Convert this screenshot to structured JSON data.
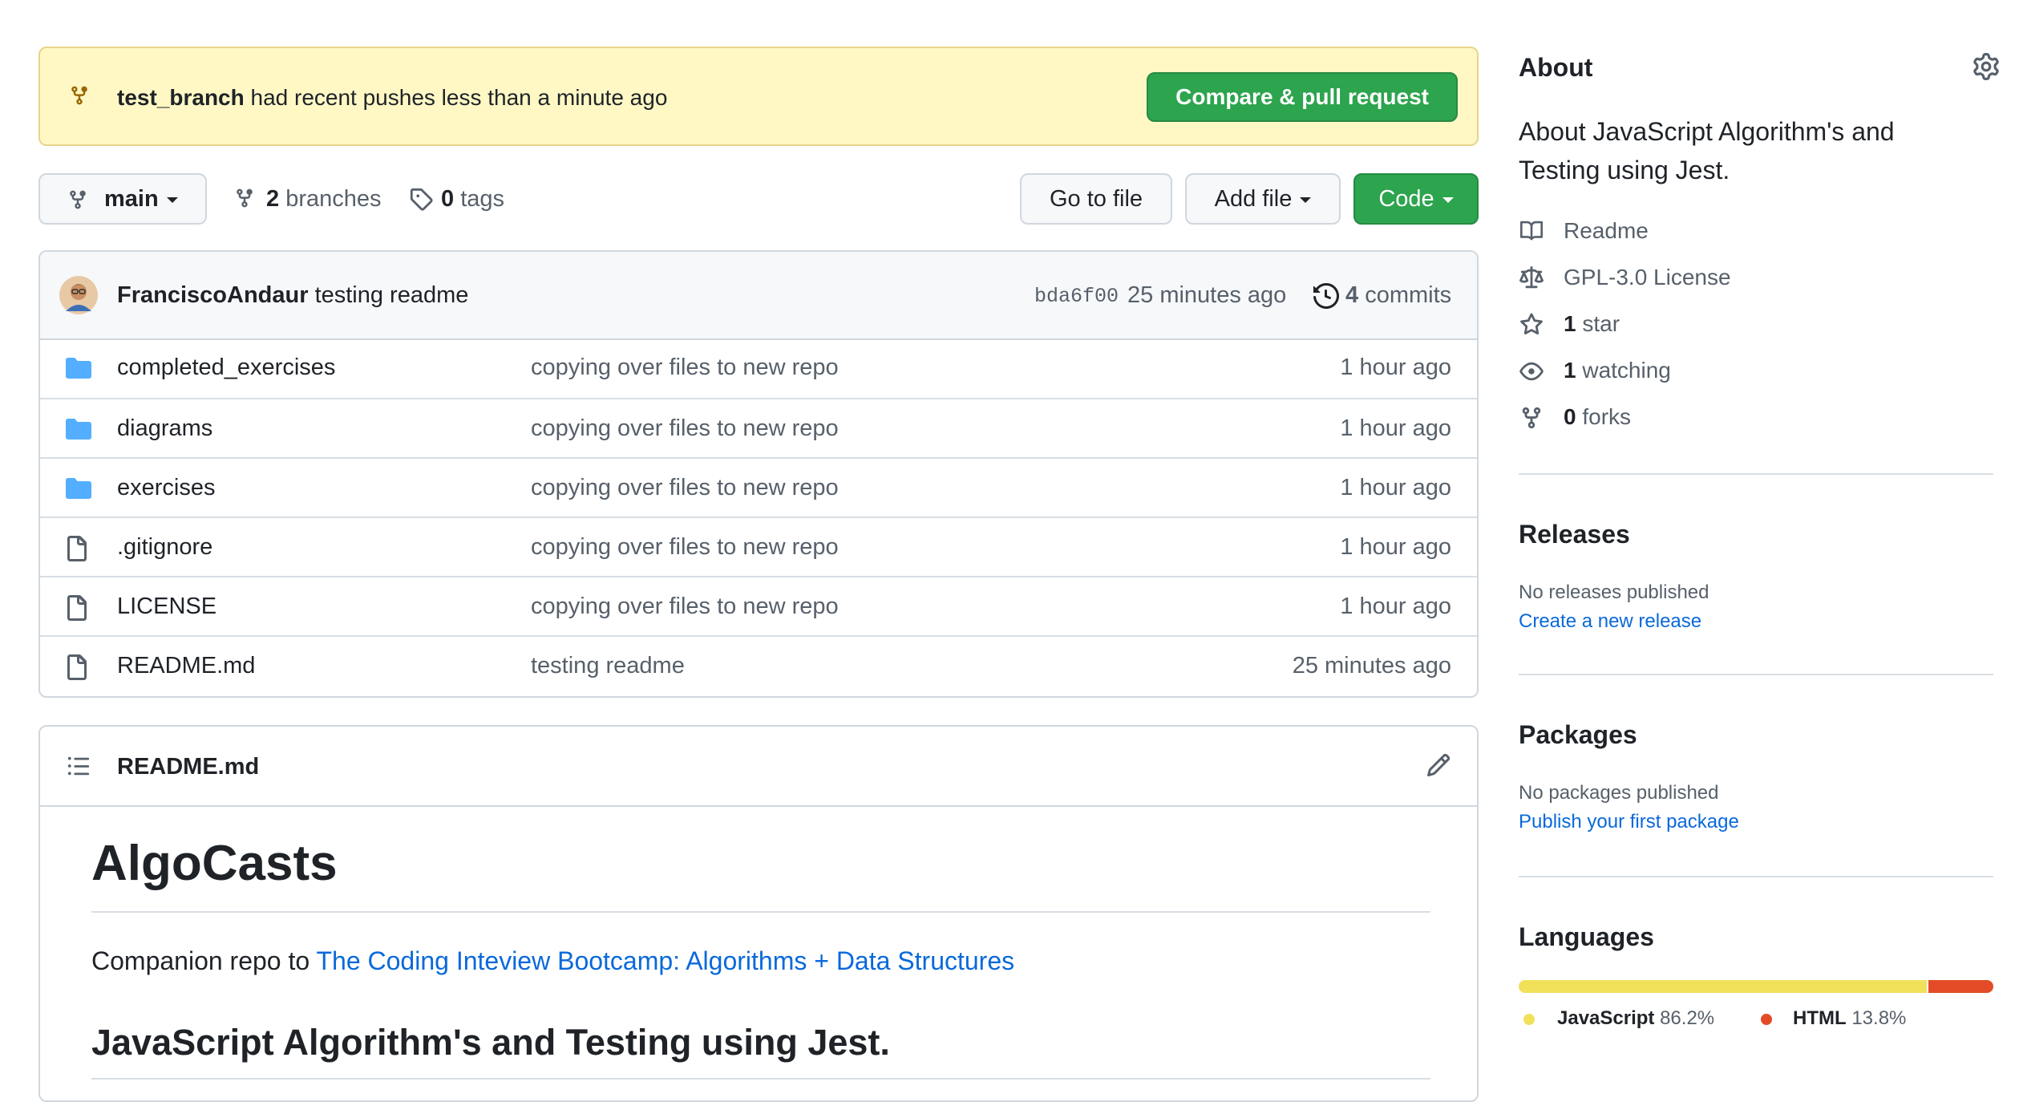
{
  "banner": {
    "branch": "test_branch",
    "message": "had recent pushes less than a minute ago",
    "button": "Compare & pull request"
  },
  "toolbar": {
    "branch": "main",
    "branches_count": "2",
    "branches_label": "branches",
    "tags_count": "0",
    "tags_label": "tags",
    "go_to_file": "Go to file",
    "add_file": "Add file",
    "code": "Code"
  },
  "commit": {
    "author": "FranciscoAndaur",
    "message": "testing readme",
    "sha": "bda6f00",
    "age": "25 minutes ago",
    "commits_count": "4",
    "commits_label": "commits"
  },
  "files": [
    {
      "name": "completed_exercises",
      "type": "folder",
      "message": "copying over files to new repo",
      "age": "1 hour ago"
    },
    {
      "name": "diagrams",
      "type": "folder",
      "message": "copying over files to new repo",
      "age": "1 hour ago"
    },
    {
      "name": "exercises",
      "type": "folder",
      "message": "copying over files to new repo",
      "age": "1 hour ago"
    },
    {
      "name": ".gitignore",
      "type": "file",
      "message": "copying over files to new repo",
      "age": "1 hour ago"
    },
    {
      "name": "LICENSE",
      "type": "file",
      "message": "copying over files to new repo",
      "age": "1 hour ago"
    },
    {
      "name": "README.md",
      "type": "file",
      "message": "testing readme",
      "age": "25 minutes ago"
    }
  ],
  "readme": {
    "filename": "README.md",
    "h1": "AlgoCasts",
    "intro_prefix": "Companion repo to ",
    "intro_link": "The Coding Inteview Bootcamp: Algorithms + Data Structures",
    "h2": "JavaScript Algorithm's and Testing using Jest."
  },
  "about": {
    "heading": "About",
    "description": "About JavaScript Algorithm's and Testing using Jest.",
    "readme": "Readme",
    "license": "GPL-3.0 License",
    "stars_count": "1",
    "stars_label": "star",
    "watching_count": "1",
    "watching_label": "watching",
    "forks_count": "0",
    "forks_label": "forks"
  },
  "releases": {
    "heading": "Releases",
    "empty": "No releases published",
    "link": "Create a new release"
  },
  "packages": {
    "heading": "Packages",
    "empty": "No packages published",
    "link": "Publish your first package"
  },
  "languages": {
    "heading": "Languages",
    "items": [
      {
        "name": "JavaScript",
        "percent": "86.2%",
        "value": 86.2,
        "color": "#f1e05a"
      },
      {
        "name": "HTML",
        "percent": "13.8%",
        "value": 13.8,
        "color": "#e34c26"
      }
    ]
  }
}
